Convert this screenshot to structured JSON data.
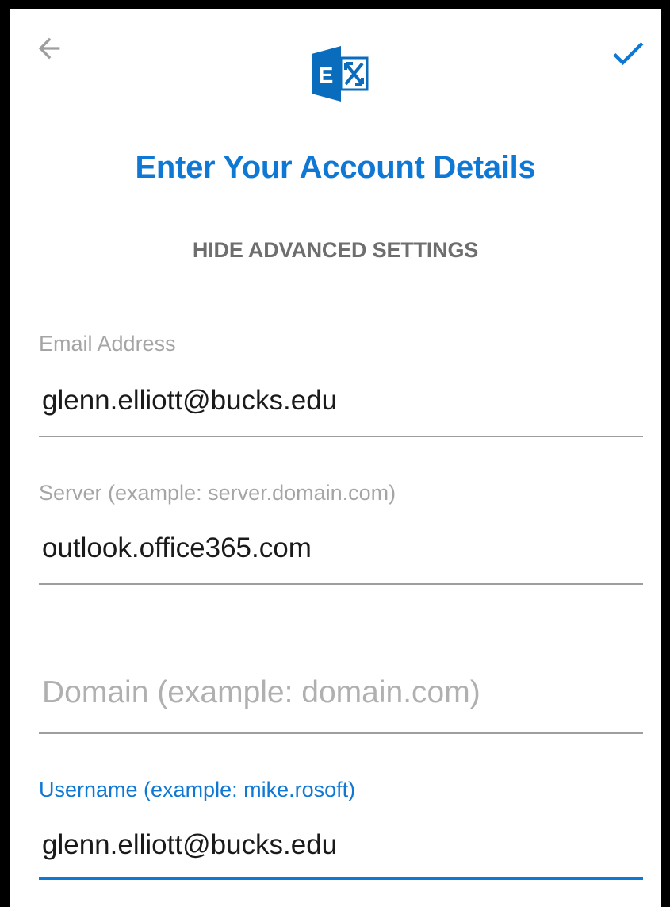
{
  "header": {
    "back_icon": "arrow-left-icon",
    "confirm_icon": "checkmark-icon",
    "logo_icon": "exchange-logo-icon",
    "logo_letter": "E"
  },
  "title": "Enter Your Account Details",
  "advanced_toggle": "HIDE ADVANCED SETTINGS",
  "fields": {
    "email": {
      "label": "Email Address",
      "value": "glenn.elliott@bucks.edu"
    },
    "server": {
      "label": "Server (example: server.domain.com)",
      "value": "outlook.office365.com"
    },
    "domain": {
      "label": "",
      "value": "",
      "placeholder": "Domain (example: domain.com)"
    },
    "username": {
      "label": "Username (example: mike.rosoft)",
      "value": "glenn.elliott@bucks.edu"
    }
  },
  "colors": {
    "accent": "#0f78d4",
    "logo_blue": "#0a6cbd",
    "muted_text": "#6e6e6e",
    "label_grey": "#a5a5a5",
    "icon_grey": "#9e9e9e"
  }
}
